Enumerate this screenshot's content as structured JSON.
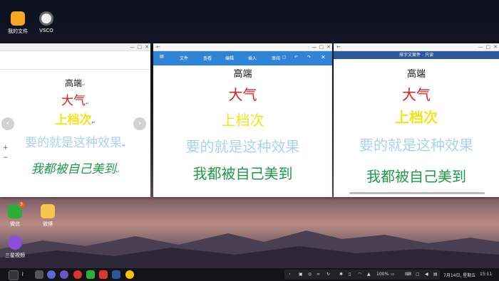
{
  "desktop": {
    "icons": [
      {
        "label": "我的文件"
      },
      {
        "label": "VSCO"
      },
      {
        "label": "微信",
        "badge": "3"
      },
      {
        "label": "微博"
      },
      {
        "label": "三星视频"
      }
    ]
  },
  "left_window": {
    "lines": [
      "高端",
      "大气",
      "上档次",
      "要的就是这种效果",
      "我都被自己美到"
    ],
    "return_mark": "↵",
    "zoom_in": "+",
    "zoom_out": "−"
  },
  "middle_window": {
    "menu": [
      "文件",
      "查看",
      "编辑",
      "插入",
      "审阅"
    ],
    "lines": [
      "高端",
      "大气",
      "上档次",
      "要的就是这种效果",
      "我都被自己美到"
    ]
  },
  "right_window": {
    "title": "排字文案件 - 只读",
    "lines": [
      "高端",
      "大气",
      "上档次",
      "要的就是这种效果",
      "我都被自己美到"
    ]
  },
  "colors": {
    "line1": "#111111",
    "line2": "#e0201c",
    "line3": "#f5e21a",
    "line4": "#a9d3ee",
    "line5": "#1f9a49",
    "word_blue": "#2f84d6",
    "word_title": "#2b579a"
  },
  "taskbar": {
    "battery": "100%",
    "date": "7月14日, 星期五",
    "time": "15:11"
  }
}
